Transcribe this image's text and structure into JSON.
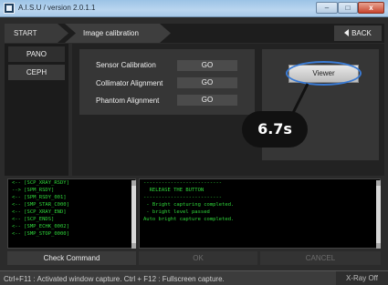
{
  "window": {
    "title": "A.I.S.U / version 2.0.1.1",
    "minimize": "–",
    "maximize": "□",
    "close": "x"
  },
  "breadcrumb": {
    "start": "START",
    "current": "Image calibration",
    "back": "BACK"
  },
  "sidebar": {
    "pano": "PANO",
    "ceph": "CEPH"
  },
  "calibration": {
    "sensor_label": "Sensor Calibration",
    "collimator_label": "Collimator Alignment",
    "phantom_label": "Phantom Alignment",
    "go": "GO"
  },
  "viewer": {
    "label": "Viewer"
  },
  "timer": "6.7s",
  "log": {
    "lines": [
      "<-- [SCP_XRAY_RSDY]",
      "--> [SPM_RSDY]",
      "<-- [SPM_RSDY_001]",
      "<-- [SMP_STAR_C000]",
      "<-- [SCP_XRAY_END]",
      "<-- [SCP_ENDS]",
      "<-- [SMP_ECHK_0002]",
      "<-- [SMP_STOP_0000]"
    ],
    "check_command": "Check Command"
  },
  "status_log": {
    "lines": [
      "--------------------------",
      "  RELEASE THE BUTTON",
      "--------------------------",
      "",
      " - Bright capturing completed.",
      " - bright level passed",
      "",
      "Auto bright capture completed."
    ]
  },
  "actions": {
    "ok": "OK",
    "cancel": "CANCEL"
  },
  "statusbar": {
    "left": "Ctrl+F11 : Activated window capture.   Ctrl + F12 : Fullscreen capture.",
    "right": "X-Ray Off"
  },
  "colors": {
    "accent_ring": "#3a7bd5",
    "log_text": "#2fd63a"
  }
}
